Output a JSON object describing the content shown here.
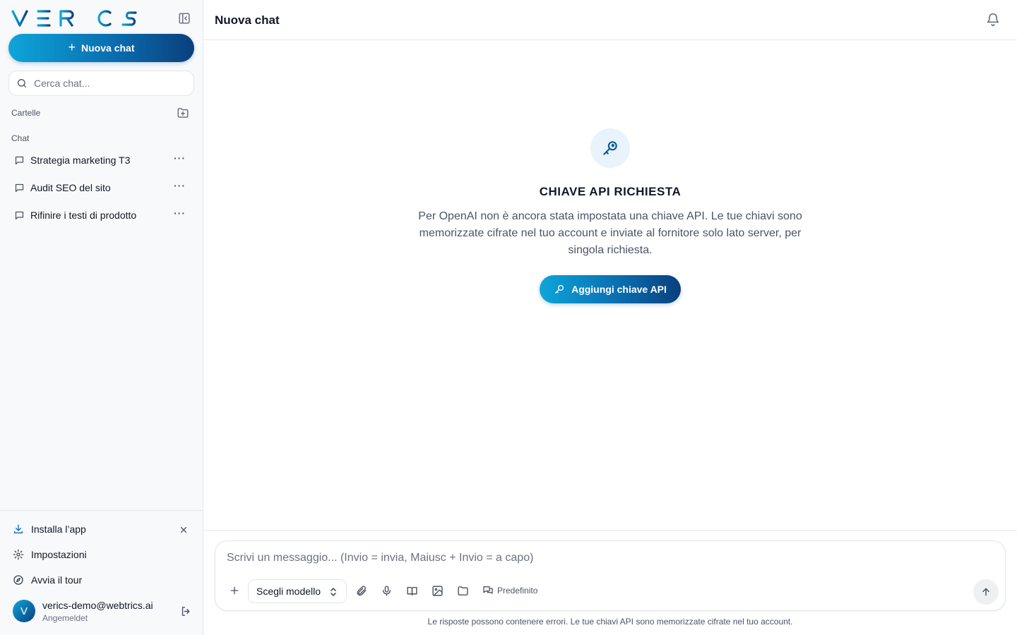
{
  "brand": {
    "logo_text": "VERICS"
  },
  "sidebar": {
    "new_chat_label": "Nuova chat",
    "search_placeholder": "Cerca chat...",
    "folders_label": "Cartelle",
    "chats_label": "Chat",
    "chats": [
      {
        "title": "Strategia marketing T3"
      },
      {
        "title": "Audit SEO del sito"
      },
      {
        "title": "Rifinire i testi di prodotto"
      }
    ],
    "bottom": {
      "install_label": "Installa l’app",
      "settings_label": "Impostazioni",
      "tour_label": "Avvia il tour"
    },
    "user": {
      "initial": "V",
      "email": "verics-demo@webtrics.ai",
      "status": "Angemeldet"
    }
  },
  "header": {
    "title": "Nuova chat"
  },
  "empty_state": {
    "title": "CHIAVE API RICHIESTA",
    "description": "Per OpenAI non è ancora stata impostata una chiave API. Le tue chiavi sono memorizzate cifrate nel tuo account e inviate al fornitore solo lato server, per singola richiesta.",
    "button_label": "Aggiungi chiave API"
  },
  "composer": {
    "placeholder": "Scrivi un messaggio... (Invio = invia, Maiusc + Invio = a capo)",
    "model_label": "Scegli modello",
    "preset_label": "Predefinito",
    "disclaimer": "Le risposte possono contenere errori. Le tue chiavi API sono memorizzate cifrate nel tuo account."
  },
  "colors": {
    "accent_start": "#0ea5d9",
    "accent_end": "#0a3f7d",
    "sidebar_bg": "#f8f9fb"
  }
}
